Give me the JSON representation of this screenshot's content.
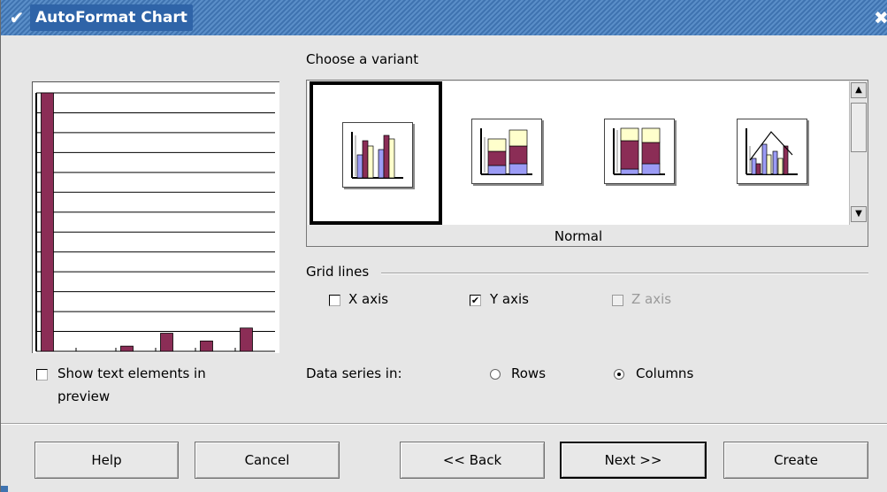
{
  "window": {
    "title": "AutoFormat Chart",
    "menu_icon": "chevron-down-icon",
    "close_icon": "close-icon"
  },
  "preview": {
    "show_text_elements_label": "Show text elements in",
    "show_text_elements_label2": "preview",
    "show_text_elements_checked": false,
    "bar_color": "#8b2d56",
    "bar_levels": [
      1.0,
      0.0,
      0.02,
      0.07,
      0.04,
      0.09
    ]
  },
  "variants": {
    "heading": "Choose a variant",
    "selected_name": "Normal",
    "items": [
      {
        "name": "Normal",
        "icon": "normal-column-chart-icon",
        "selected": true
      },
      {
        "name": "Stacked",
        "icon": "stacked-column-chart-icon",
        "selected": false
      },
      {
        "name": "Percent stacked",
        "icon": "percent-stacked-column-chart-icon",
        "selected": false
      },
      {
        "name": "Columns and lines",
        "icon": "column-line-chart-icon",
        "selected": false
      }
    ]
  },
  "grid_lines": {
    "heading": "Grid lines",
    "x_axis": {
      "label": "X axis",
      "checked": false,
      "enabled": true
    },
    "y_axis": {
      "label": "Y axis",
      "checked": true,
      "enabled": true
    },
    "z_axis": {
      "label": "Z axis",
      "checked": false,
      "enabled": false
    }
  },
  "data_series": {
    "label": "Data series in:",
    "rows_label": "Rows",
    "columns_label": "Columns",
    "selected": "Columns"
  },
  "buttons": {
    "help": "Help",
    "cancel": "Cancel",
    "back": "<< Back",
    "next": "Next >>",
    "create": "Create"
  },
  "colors": {
    "bar_purple": "#8b2d56",
    "bar_blue": "#9b9bf5",
    "bar_yellow": "#ffffcc",
    "titlebar": "#3f73b0"
  }
}
